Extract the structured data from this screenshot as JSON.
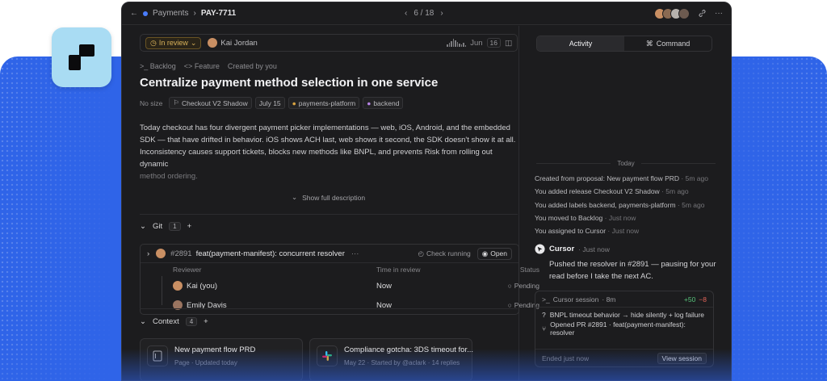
{
  "titlebar": {
    "breadcrumb_parent": "Payments",
    "issue_id": "PAY-7711",
    "pager": "6 / 18"
  },
  "status": {
    "state": "In review",
    "assignee": "Kai Jordan",
    "due": "Jun",
    "due_day": "16"
  },
  "breadcrumbs": [
    "Backlog",
    "Feature",
    "Created by you"
  ],
  "issue": {
    "title": "Centralize payment method selection in one service",
    "size": "No size",
    "project": "Checkout V2 Shadow",
    "date": "July 15",
    "labels": [
      "payments-platform",
      "backend"
    ],
    "description_1": "Today checkout has four divergent payment picker implementations —  web, iOS, Android, and the embedded SDK — that have drifted in behavior. iOS shows ACH last, web shows it second, the SDK doesn't show it at all. Inconsistency causes support tickets, blocks new methods like BNPL, and prevents Risk from rolling out dynamic",
    "description_fade": "method ordering.",
    "show_full": "Show full description"
  },
  "git": {
    "label": "Git",
    "count": "1",
    "pr_number": "#2891",
    "pr_title": "feat(payment-manifest): concurrent resolver",
    "more": "···",
    "check": "Check running",
    "open": "Open",
    "columns": {
      "reviewer": "Reviewer",
      "time": "Time in review",
      "status": "Status"
    },
    "reviewers": [
      {
        "name": "Kai (you)",
        "time": "Now",
        "status": "Pending"
      },
      {
        "name": "Emily Davis",
        "time": "Now",
        "status": "Pending"
      }
    ]
  },
  "context": {
    "label": "Context",
    "count": "4",
    "cards": [
      {
        "title": "New payment flow PRD",
        "sub": "Page · Updated today"
      },
      {
        "title": "Compliance gotcha: 3DS timeout for...",
        "sub": "May 22 · Started by @aclark · 14 replies"
      }
    ]
  },
  "side": {
    "tab_activity": "Activity",
    "tab_command": "Command",
    "today": "Today",
    "activity": [
      {
        "text": "Created from proposal: New payment flow PRD",
        "time": "· 5m ago"
      },
      {
        "text": "You added release Checkout V2 Shadow",
        "time": "· 5m ago"
      },
      {
        "text": "You added labels backend, payments-platform",
        "time": "· 5m ago"
      },
      {
        "text": "You moved to Backlog",
        "time": "· Just now"
      },
      {
        "text": "You assigned to Cursor",
        "time": "· Just now"
      }
    ],
    "cursor_name": "Cursor",
    "cursor_time": "· Just now",
    "cursor_msg": "Pushed the resolver in #2891 — pausing for your read before I take the next AC.",
    "session_title": "Cursor session",
    "session_time": "· 8m",
    "plus": "+50",
    "minus": "−8",
    "session_items": [
      "BNPL timeout behavior → hide silently + log failure",
      "Opened PR #2891 · feat(payment-manifest): resolver"
    ],
    "session_foot": "Ended just now",
    "view_session": "View session"
  },
  "colors": {
    "brand_blue": "#2f64e8",
    "logo_tile": "#a9dcf3",
    "review_amber": "#d9b25a"
  }
}
